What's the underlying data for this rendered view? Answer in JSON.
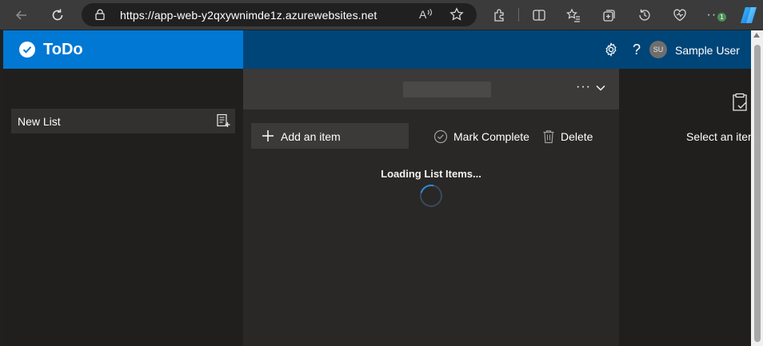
{
  "browser": {
    "url": "https://app-web-y2qxywnimde1z.azurewebsites.net",
    "notification_badge": "1"
  },
  "app": {
    "title": "ToDo",
    "user_initials": "SU",
    "user_name": "Sample User",
    "colors": {
      "brand": "#0078d4",
      "header": "#004578",
      "spinner": "#2f8ae0"
    }
  },
  "sidebar": {
    "items": [
      {
        "label": "New List"
      }
    ]
  },
  "toolbar": {
    "add_item_label": "Add an item",
    "mark_complete_label": "Mark Complete",
    "delete_label": "Delete"
  },
  "main": {
    "loading_text": "Loading List Items..."
  },
  "detail": {
    "empty_text": "Select an item"
  }
}
